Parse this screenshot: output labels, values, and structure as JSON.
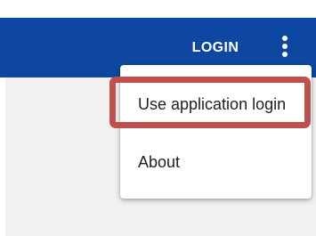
{
  "app_bar": {
    "login_label": "LOGIN",
    "overflow_icon": "more-vert-icon",
    "color": "#0d47a1"
  },
  "menu": {
    "items": [
      {
        "label": "Use application login",
        "highlighted": true
      },
      {
        "label": "About"
      }
    ]
  },
  "highlight_color": "#c0504d"
}
